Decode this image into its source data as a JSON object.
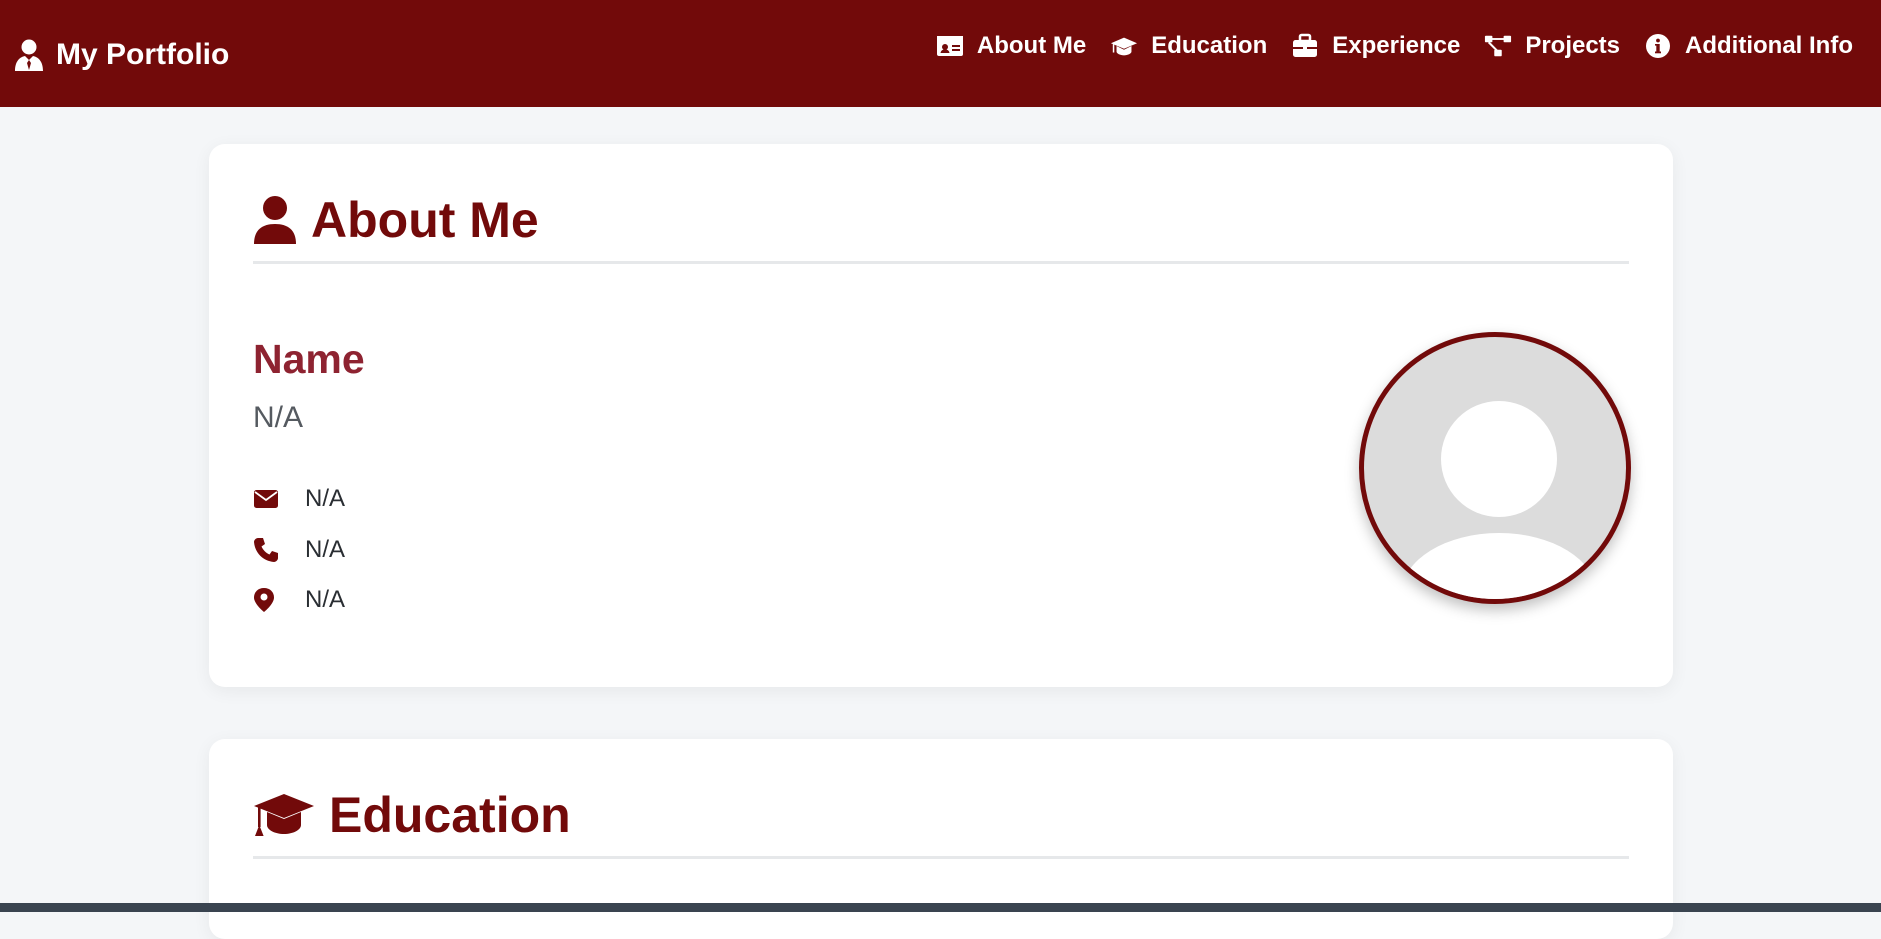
{
  "navbar": {
    "brand": "My Portfolio",
    "brand_icon": "user-tie-icon",
    "links": [
      {
        "label": "About Me",
        "icon": "id-card-icon"
      },
      {
        "label": "Education",
        "icon": "graduation-cap-icon"
      },
      {
        "label": "Experience",
        "icon": "briefcase-icon"
      },
      {
        "label": "Projects",
        "icon": "project-diagram-icon"
      },
      {
        "label": "Additional Info",
        "icon": "info-circle-icon"
      }
    ]
  },
  "about": {
    "title": "About Me",
    "name_label": "Name",
    "name_value": "N/A",
    "email": "N/A",
    "phone": "N/A",
    "location": "N/A"
  },
  "education": {
    "title": "Education"
  },
  "colors": {
    "primary": "#720a0a",
    "accent": "#8e2331",
    "background": "#f4f6f8",
    "card": "#ffffff"
  }
}
